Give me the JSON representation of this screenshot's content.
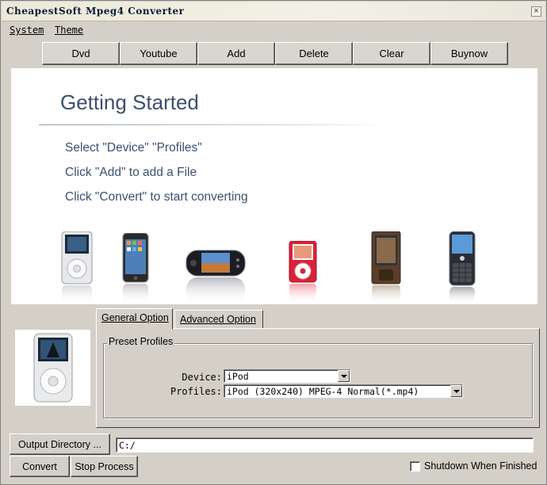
{
  "window": {
    "title": "CheapestSoft Mpeg4 Converter",
    "close_glyph": "×"
  },
  "menu": {
    "items": [
      "System",
      "Theme"
    ]
  },
  "toolbar": {
    "buttons": [
      "Dvd",
      "Youtube",
      "Add",
      "Delete",
      "Clear",
      "Buynow"
    ]
  },
  "getting_started": {
    "title": "Getting Started",
    "lines": [
      "Select \"Device\" \"Profiles\"",
      "Click  \"Add\" to add a File",
      "Click  \"Convert\" to start converting"
    ],
    "devices": [
      "ipod-classic",
      "iphone",
      "psp",
      "ipod-nano",
      "zune",
      "blackberry"
    ]
  },
  "tabs": {
    "items": [
      "General Option",
      "Advanced Option"
    ],
    "active": "General Option"
  },
  "preset": {
    "group_label": "Preset Profiles",
    "device_label": "Device:",
    "device_value": "iPod",
    "profiles_label": "Profiles:",
    "profiles_value": "iPod (320x240) MPEG-4 Normal(*.mp4)"
  },
  "output": {
    "button_label": "Output Directory ...",
    "path": "C:/"
  },
  "actions": {
    "convert_label": "Convert",
    "stop_label": "Stop Process"
  },
  "shutdown": {
    "label": "Shutdown When Finished",
    "checked": false
  }
}
